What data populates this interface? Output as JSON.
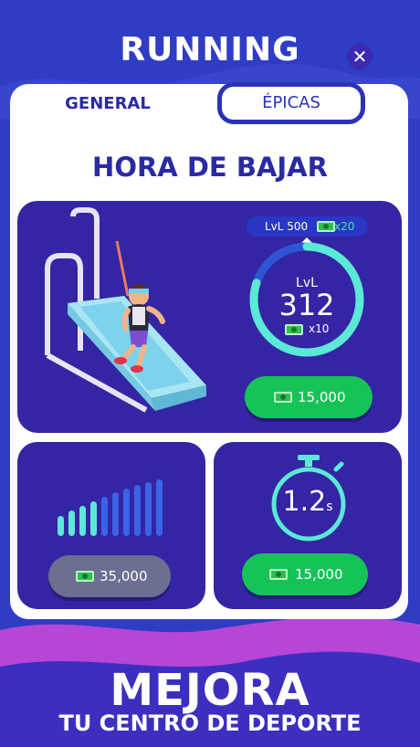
{
  "header": {
    "title": "RUNNING",
    "close_icon": "close-icon"
  },
  "tabs": [
    {
      "label": "GENERAL",
      "active": true
    },
    {
      "label": "ÉPICAS",
      "active": false
    }
  ],
  "section": {
    "title": "HORA DE BAJAR"
  },
  "main_card": {
    "illustration": "runner-on-treadmill",
    "next_level_badge": {
      "level_text": "LvL 500",
      "reward": "x20"
    },
    "level_ring": {
      "label": "LvL",
      "value": "312",
      "multiplier": "x10",
      "progress": 0.8
    },
    "upgrade_button": {
      "price": "15,000",
      "icon": "cash-icon"
    }
  },
  "left_card": {
    "icon": "signal-bars-icon",
    "upgrade_button": {
      "price": "35,000",
      "icon": "cash-icon",
      "disabled": true
    }
  },
  "right_card": {
    "icon": "stopwatch-icon",
    "timer": {
      "value": "1.2",
      "unit": "s"
    },
    "upgrade_button": {
      "price": "15,000",
      "icon": "cash-icon"
    }
  },
  "footer": {
    "line1": "MEJORA",
    "line2": "TU CENTRO DE DEPORTE"
  },
  "colors": {
    "background": "#2f3cc4",
    "card": "#3325a4",
    "accent_teal": "#5ce8d6",
    "button_green": "#16c357",
    "button_grey": "#6c6f91",
    "title_blue": "#2a2aa3",
    "footer_magenta": "#b646d8"
  }
}
